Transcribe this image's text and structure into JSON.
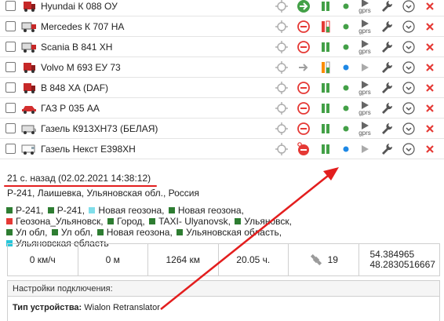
{
  "units": [
    {
      "name": "Hyundai К 088 ОУ",
      "vehicle_icon": "truck-red-icon",
      "status_icon": "moving-arrow-green-icon",
      "ignition_icon": "pause-green-icon",
      "motion_dot": "green",
      "signal_icon": "gprs-icon",
      "gprs_label": "gprs"
    },
    {
      "name": "Mercedes К 707 НА",
      "vehicle_icon": "truck-icon",
      "status_icon": "no-entry-icon",
      "ignition_icon": "fuel-red-icon",
      "motion_dot": "green",
      "signal_icon": "gprs-icon",
      "gprs_label": "gprs"
    },
    {
      "name": "Scania В 841 ХН",
      "vehicle_icon": "truck-icon",
      "status_icon": "no-entry-icon",
      "ignition_icon": "pause-green-icon",
      "motion_dot": "green",
      "signal_icon": "gprs-icon",
      "gprs_label": "gprs"
    },
    {
      "name": "Volvo М 693 ЕУ 73",
      "vehicle_icon": "truck-red-icon",
      "status_icon": "arrow-gray-icon",
      "ignition_icon": "fuel-orange-icon",
      "motion_dot": "blue",
      "signal_icon": "play-gray-icon",
      "gprs_label": ""
    },
    {
      "name": "В 848 ХА (DAF)",
      "vehicle_icon": "truck-red-icon",
      "status_icon": "no-entry-icon",
      "ignition_icon": "pause-green-icon",
      "motion_dot": "green",
      "signal_icon": "gprs-icon",
      "gprs_label": "gprs"
    },
    {
      "name": "ГАЗ Р 035 АА",
      "vehicle_icon": "car-red-icon",
      "status_icon": "no-entry-icon",
      "ignition_icon": "pause-green-icon",
      "motion_dot": "green",
      "signal_icon": "gprs-icon",
      "gprs_label": "gprs"
    },
    {
      "name": "Газель К913ХН73 (БЕЛАЯ)",
      "vehicle_icon": "van-icon",
      "status_icon": "no-entry-icon",
      "ignition_icon": "pause-green-icon",
      "motion_dot": "green",
      "signal_icon": "gprs-icon",
      "gprs_label": "gprs"
    },
    {
      "name": "Газель Некст Е398ХН",
      "vehicle_icon": "van-white-icon",
      "status_icon": "no-entry-red-pin-icon",
      "ignition_icon": "pause-green-icon",
      "motion_dot": "blue",
      "signal_icon": "play-gray-icon",
      "gprs_label": ""
    }
  ],
  "details": {
    "time": "21 с. назад (02.02.2021 14:38:12)",
    "address": "Р-241, Лаишевка, Ульяновская обл., Россия",
    "geozones": [
      {
        "label": "Р-241,",
        "color": "#2e7d32"
      },
      {
        "label": "Р-241,",
        "color": "#2e7d32"
      },
      {
        "label": "Новая геозона,",
        "color": "#80deea"
      },
      {
        "label": "Новая геозона,",
        "color": "#2e7d32"
      },
      {
        "label": "Геозона_Ульяновск,",
        "color": "#e53935"
      },
      {
        "label": "Город,",
        "color": "#2e7d32"
      },
      {
        "label": "TAXI- Ulyanovsk,",
        "color": "#2e7d32"
      },
      {
        "label": "Ульяновск,",
        "color": "#2e7d32"
      },
      {
        "label": "Ул обл,",
        "color": "#2e7d32"
      },
      {
        "label": "Ул обл,",
        "color": "#2e7d32"
      },
      {
        "label": "Новая геозона,",
        "color": "#2e7d32"
      },
      {
        "label": "Ульяновская область,",
        "color": "#2e7d32"
      },
      {
        "label": "Ульяновская область",
        "color": "#26c6da"
      }
    ],
    "speed": "0 км/ч",
    "altitude": "0 м",
    "mileage": "1264 км",
    "engine_hours": "20.05 ч.",
    "satellites": "19",
    "latitude": "54.384965",
    "longitude": "48.2830516667",
    "connection": {
      "title": "Настройки подключения:",
      "type_label": "Тип устройства:",
      "type_value": "Wialon Retranslator"
    }
  },
  "colors": {
    "green": "#43a047",
    "blue": "#1e88e5",
    "red": "#e53935",
    "orange": "#fb8c00",
    "annotation_red": "#e31e1e"
  }
}
